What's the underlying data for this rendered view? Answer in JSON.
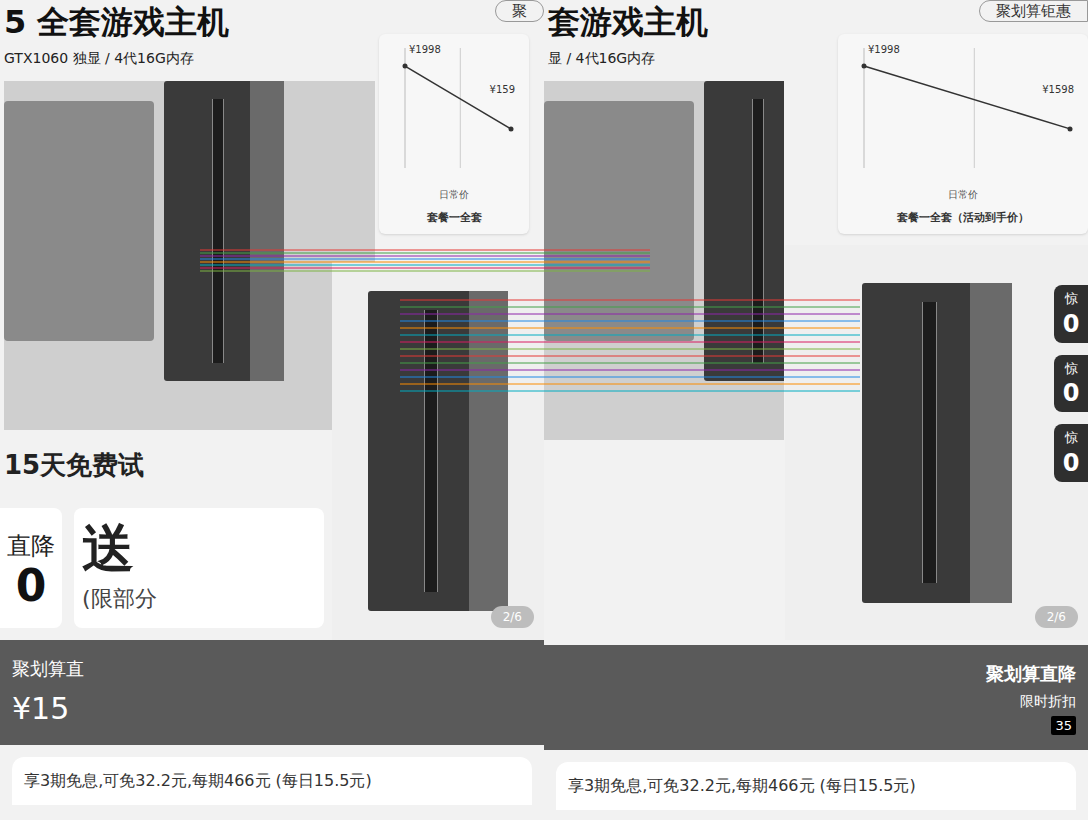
{
  "left": {
    "title": "5 全套游戏主机",
    "spec": "GTX1060 独显 / 4代16G内存",
    "top_button": "聚",
    "chart": {
      "price_high": "¥1998",
      "price_low": "¥159",
      "label_daily": "日常价",
      "caption": "套餐一全套",
      "series": [
        1998,
        1598
      ]
    },
    "trial": "15天免费试",
    "promo": {
      "cut_label": "直降",
      "cut_value": "0",
      "gift": "送",
      "gift_note": "(限部分"
    },
    "gallery_counter": "2/6",
    "deal_bar": {
      "title": "聚划算直",
      "price": "¥15"
    },
    "installment": "享3期免息,可免32.2元,每期466元 (每日15.5元)"
  },
  "right": {
    "title": "套游戏主机",
    "spec": "显 / 4代16G内存",
    "top_button": "聚划算钜惠",
    "chart": {
      "price_high": "¥1998",
      "price_low": "¥1598",
      "label_daily": "日常价",
      "caption": "套餐一全套（活动到手价）",
      "series": [
        1998,
        1598
      ]
    },
    "gallery_counter": "2/6",
    "side_buttons": [
      {
        "label": "惊",
        "value": "0"
      },
      {
        "label": "惊",
        "value": "0"
      },
      {
        "label": "惊",
        "value": "0"
      }
    ],
    "deal_bar": {
      "title": "聚划算直降",
      "subtitle": "限时折扣",
      "countdown": "35"
    },
    "installment": "享3期免息,可免32.2元,每期466元 (每日15.5元)"
  }
}
